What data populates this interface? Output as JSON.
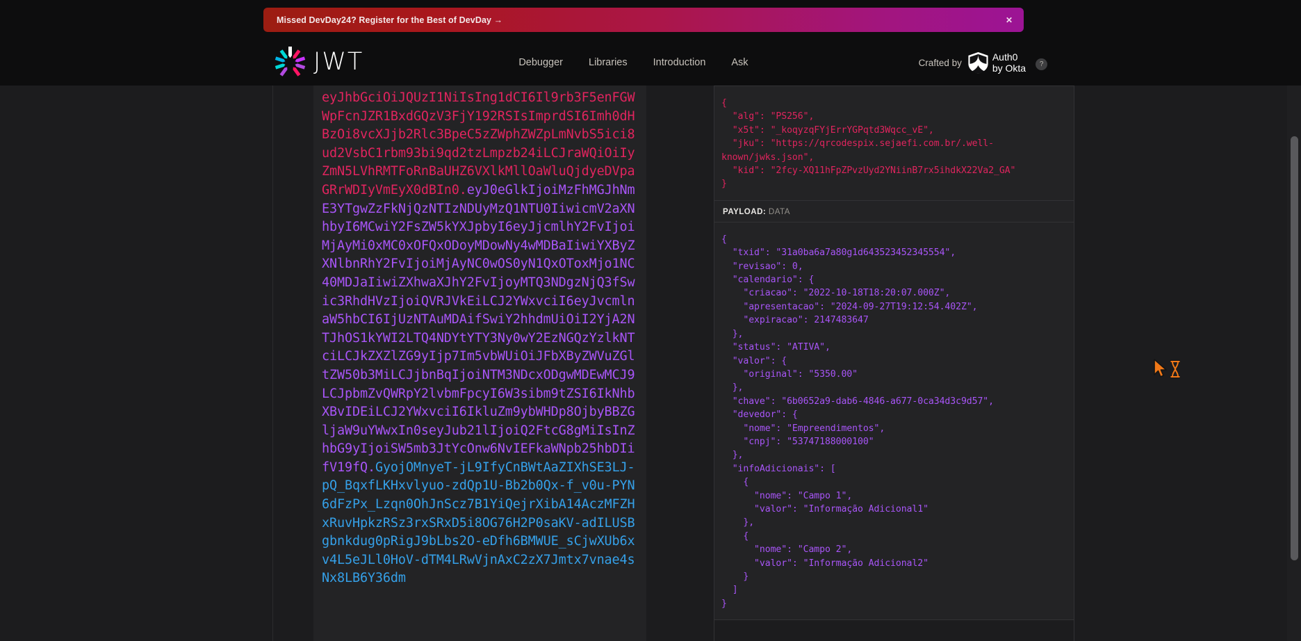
{
  "banner": {
    "text": "Missed DevDay24? Register for the Best of DevDay  →",
    "close_label": "✕",
    "gradient_from": "#9c1d12",
    "gradient_to": "#9c1495"
  },
  "header": {
    "logo_word": "JWT",
    "logo_icon": "jwt-pinwheel-logo",
    "nav": [
      {
        "label": "Debugger"
      },
      {
        "label": "Libraries"
      },
      {
        "label": "Introduction"
      },
      {
        "label": "Ask"
      }
    ],
    "crafted": {
      "label": "Crafted by",
      "brand_line1": "Auth0",
      "brand_line2": "by Okta",
      "help_badge": "?"
    }
  },
  "token": {
    "header_b64": "eyJhbGciOiJQUzI1NiIsIng1dCI6Il9rb3F5enFGWWpFcnJZR1BxdGQzV3FjY192RSIsImprdSI6Imh0dHBzOi8vcXJjb2Rlc3BpeC5zZWphZWZpLmNvbS5ici8ud2VsbC1rbm93bi9qd2tzLmpzb24iLCJraWQiOiIyZmN5LVhRMTFoRnBaUHZ6VXlkMllOaWluQjdyeDVpaGRrWDIyVmEyX0dBIn0",
    "dot1": ".",
    "payload_b64": "eyJ0eGlkIjoiMzFhMGJhNmE3YTgwZzFkNjQzNTIzNDUyMzQ1NTU0IiwicmV2aXNhbyI6MCwiY2FsZW5kYXJpbyI6eyJjcmlhY2FvIjoiMjAyMi0xMC0xOFQxODoyMDowNy4wMDBaIiwiYXByZXNlbnRhY2FvIjoiMjAyNC0wOS0yN1QxOToxMjo1NC40MDJaIiwiZXhwaXJhY2FvIjoyMTQ3NDgzNjQ3fSwic3RhdHVzIjoiQVRJVkEiLCJ2YWxvciI6eyJvcmlnaW5hbCI6IjUzNTAuMDAifSwiY2hhdmUiOiI2YjA2NTJhOS1kYWI2LTQ4NDYtYTY3Ny0wY2EzNGQzYzlkNTciLCJkZXZlZG9yIjp7Im5vbWUiOiJFbXByZWVuZGltZW50b3MiLCJjbnBqIjoiNTM3NDcxODgwMDEwMCJ9LCJpbmZvQWRpY2lvbmFpcyI6W3sibm9tZSI6IkNhbXBvIDEiLCJ2YWxvciI6IkluZm9ybWHDp8OjbyBBZGljaW9uYWwxIn0seyJub21lIjoiQ2FtcG8gMiIsInZhbG9yIjoiSW5mb3JtYcOnw6NvIEFkaWNpb25hbDIifV19fQ",
    "dot2": ".",
    "signature_b64": "GyojOMnyeT-jL9IfyCnBWtAaZIXhSE3LJ-pQ_BqxfLKHxvlyuo-zdQp1U-Bb2b0Qx-f_v0u-PYN6dFzPx_Lzqn0OhJnScz7B1YiQejrXibA14AczMFZHxRuvHpkzRSz3rxSRxD5i8OG76H2P0saKV-adILUSBgbnkdug0pRigJ9bLbs2O-eDfh6BMWUE_sCjwXUb6xv4L5eJLl0HoV-dTM4LRwVjnAxC2zX7Jmtx7vnae4sNx8LB6Y36dm",
    "colors": {
      "header": "#e0245e",
      "payload": "#a855f7",
      "signature": "#35a0e8"
    }
  },
  "decoded": {
    "header_panel": {
      "code": "{\n  \"alg\": \"PS256\",\n  \"x5t\": \"_koqyzqFYjErrYGPqtd3Wqcc_vE\",\n  \"jku\": \"https://qrcodespix.sejaefi.com.br/.well-known/jwks.json\",\n  \"kid\": \"2fcy-XQ11hFpZPvzUyd2YNiinB7rx5ihdkX22Va2_GA\"\n}"
    },
    "payload_label": {
      "title": "PAYLOAD:",
      "subtitle": "DATA"
    },
    "payload_panel": {
      "code": "{\n  \"txid\": \"31a0ba6a7a80g1d643523452345554\",\n  \"revisao\": 0,\n  \"calendario\": {\n    \"criacao\": \"2022-10-18T18:20:07.000Z\",\n    \"apresentacao\": \"2024-09-27T19:12:54.402Z\",\n    \"expiracao\": 2147483647\n  },\n  \"status\": \"ATIVA\",\n  \"valor\": {\n    \"original\": \"5350.00\"\n  },\n  \"chave\": \"6b0652a9-dab6-4846-a677-0ca34d3c9d57\",\n  \"devedor\": {\n    \"nome\": \"Empreendimentos\",\n    \"cnpj\": \"53747188000100\"\n  },\n  \"infoAdicionais\": [\n    {\n      \"nome\": \"Campo 1\",\n      \"valor\": \"Informação Adicional1\"\n    },\n    {\n      \"nome\": \"Campo 2\",\n      \"valor\": \"Informação Adicional2\"\n    }\n  ]\n}"
    }
  },
  "cursor": {
    "icon": "arrow-hourglass-busy-cursor",
    "color": "#f07818"
  },
  "scrollbar": {
    "thumb_color": "#59595c"
  }
}
